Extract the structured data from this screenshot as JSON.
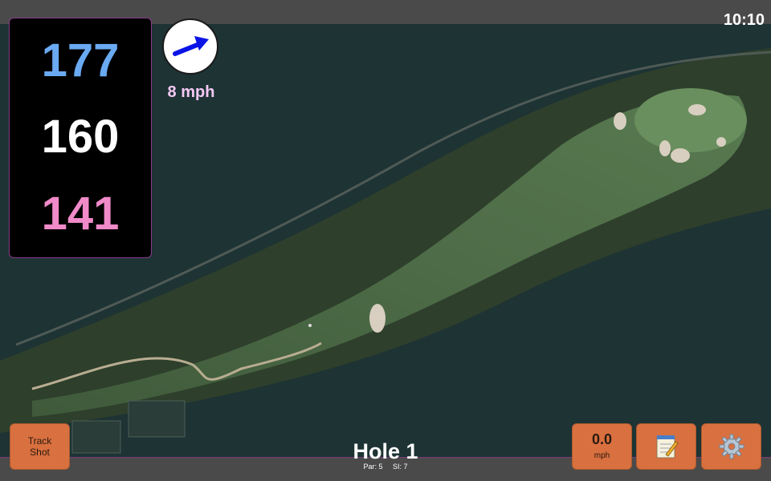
{
  "status_bar": {
    "time": "10:10"
  },
  "yardages": {
    "back": "177",
    "middle": "160",
    "front": "141",
    "back_color": "#6aaaf2",
    "middle_color": "#ffffff",
    "front_color": "#f08ac8"
  },
  "wind": {
    "speed_label": "8 mph",
    "arrow_icon": "wind-direction-arrow-icon",
    "arrow_color": "#0a14e6",
    "label_color": "#f4c8f4"
  },
  "hole": {
    "title": "Hole 1",
    "par_label": "Par: 5",
    "si_label": "SI: 7"
  },
  "buttons": {
    "track_shot_line1": "Track",
    "track_shot_line2": "Shot",
    "speed_value": "0.0",
    "speed_unit": "mph",
    "notes_icon": "notepad-icon",
    "settings_icon": "gear-icon",
    "button_color": "#d9703f"
  },
  "map": {
    "type": "satellite-golf-hole-view"
  }
}
